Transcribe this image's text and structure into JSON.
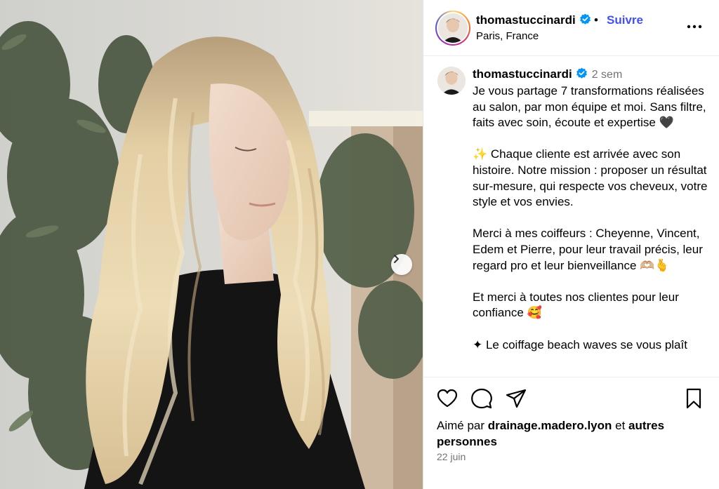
{
  "post": {
    "username": "thomastuccinardi",
    "location": "Paris, France",
    "follow_label": "Suivre",
    "dot": "•",
    "more_icon": "more-horizontal-icon"
  },
  "caption": {
    "username": "thomastuccinardi",
    "time": "2 sem",
    "text": "Je vous partage 7 transformations réalisées au salon, par mon équipe et moi. Sans filtre, faits avec soin, écoute et expertise 🖤\n\n✨ Chaque cliente est arrivée avec son histoire. Notre mission : proposer un résultat sur-mesure, qui respecte vos cheveux, votre style et vos envies.\n\nMerci à mes coiffeurs : Cheyenne, Vincent, Edem et Pierre, pour leur travail précis, leur regard pro et leur bienveillance 🫶🏼🫰\n\nEt merci à toutes nos clientes pour leur confiance 🥰\n\n✦ Le coiffage beach waves se vous plaît"
  },
  "engagement": {
    "liked_prefix": "Aimé par ",
    "liked_user": "drainage.madero.lyon",
    "liked_middle": " et ",
    "liked_suffix": "autres personnes",
    "date": "22 juin"
  },
  "icons": [
    "heart-icon",
    "comment-icon",
    "share-icon",
    "bookmark-icon",
    "chevron-right-icon",
    "verified-badge-icon"
  ],
  "colors": {
    "accent": "#4150f7",
    "verified": "#0095f6",
    "muted": "#737373"
  }
}
